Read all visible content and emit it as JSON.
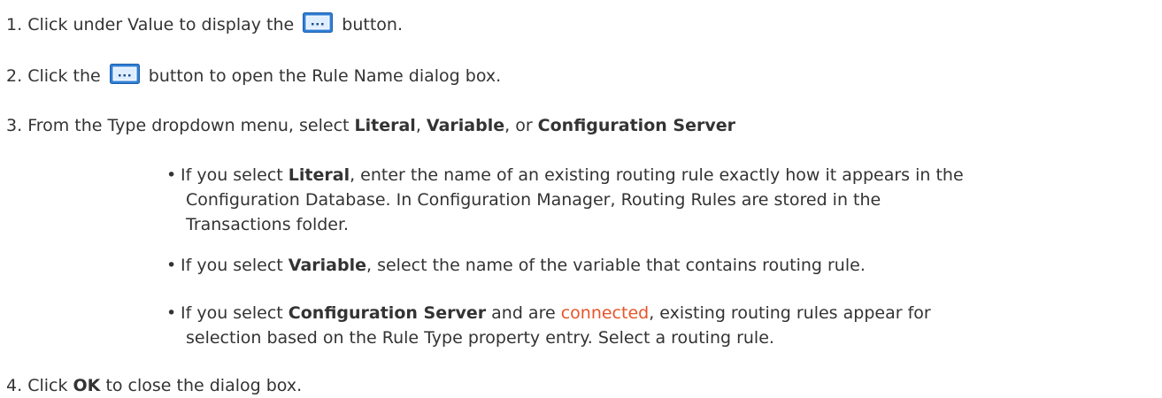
{
  "steps": [
    {
      "number": "1.",
      "text_before": "Click under Value to display the",
      "text_after": "button."
    },
    {
      "number": "2.",
      "text_before": "Click the",
      "text_after": "button to open the Rule Name dialog box."
    },
    {
      "number": "3.",
      "text_before": "From the Type dropdown menu, select",
      "bold1": "Literal",
      "sep1": ",",
      "bold2": "Variable",
      "sep2": ", or",
      "bold3": "Configuration Server"
    },
    {
      "number": "4.",
      "text_before": "Click",
      "bold": "OK",
      "text_after": "to close the dialog box."
    }
  ],
  "bullets": [
    {
      "dot": "•",
      "prefix": "If you select",
      "bold": "Literal",
      "line1_rest": ", enter the name of an existing routing rule exactly how it appears in the",
      "line2": "Configuration Database. In Configuration Manager, Routing Rules are stored in the",
      "line3": "Transactions folder."
    },
    {
      "dot": "•",
      "prefix": "If you select",
      "bold": "Variable",
      "rest": ", select the name of the variable that contains routing rule."
    },
    {
      "dot": "•",
      "prefix": "If you select",
      "bold": "Configuration Server",
      "middle": "and are",
      "link": "connected",
      "line1_rest": ", existing routing rules appear for",
      "line2": "selection based on the Rule Type property entry. Select a routing rule."
    }
  ],
  "icons": {
    "browse_button": "ellipsis-button-icon"
  },
  "colors": {
    "text": "#333333",
    "link": "#e8542a",
    "icon_blue": "#2f7fd6"
  }
}
